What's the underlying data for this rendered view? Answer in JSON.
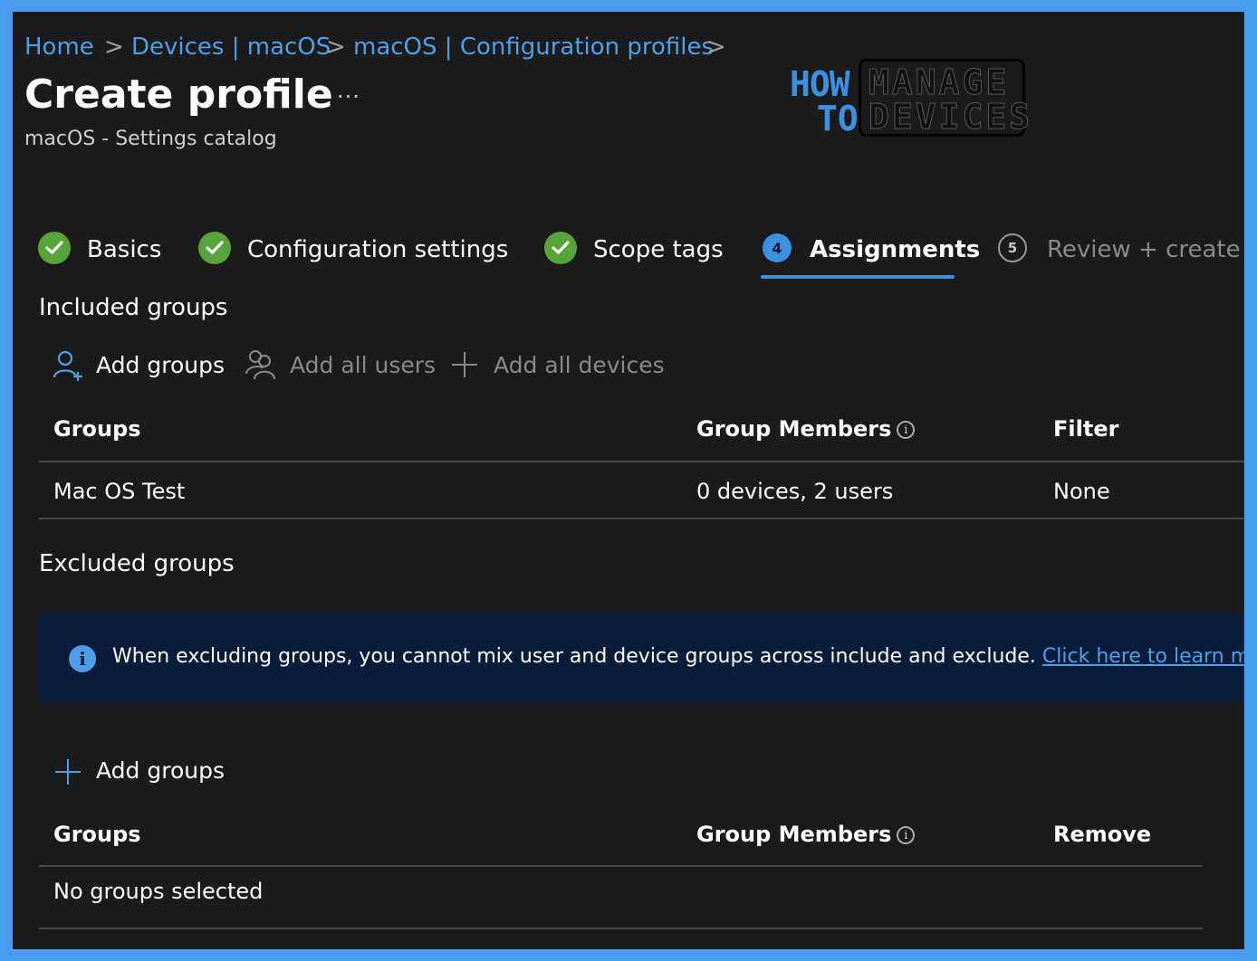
{
  "breadcrumb": {
    "items": [
      "Home",
      "Devices | macOS",
      "macOS | Configuration profiles"
    ],
    "separator": ">"
  },
  "page": {
    "title": "Create profile",
    "more": "···",
    "subtitle": "macOS - Settings catalog"
  },
  "logo": {
    "how": "HOW",
    "to": "TO",
    "manage": "MANAGE",
    "devices": "DEVICES"
  },
  "steps": [
    {
      "label": "Basics",
      "state": "done"
    },
    {
      "label": "Configuration settings",
      "state": "done"
    },
    {
      "label": "Scope tags",
      "state": "done"
    },
    {
      "number": "4",
      "label": "Assignments",
      "state": "active"
    },
    {
      "number": "5",
      "label": "Review + create",
      "state": "inactive"
    }
  ],
  "included": {
    "title": "Included groups",
    "commands": {
      "add_groups": "Add groups",
      "add_all_users": "Add all users",
      "add_all_devices": "Add all devices"
    },
    "columns": [
      "Groups",
      "Group Members",
      "Filter"
    ],
    "rows": [
      {
        "group": "Mac OS Test",
        "members": "0 devices, 2 users",
        "filter": "None"
      }
    ]
  },
  "excluded": {
    "title": "Excluded groups",
    "info": {
      "text": "When excluding groups, you cannot mix user and device groups across include and exclude. ",
      "link": "Click here to learn more ab"
    },
    "add_groups": "Add groups",
    "columns": [
      "Groups",
      "Group Members",
      "Remove"
    ],
    "empty": "No groups selected"
  },
  "colors": {
    "accent": "#3d8fe0",
    "link": "#4f9fe8",
    "success": "#57a43a",
    "background": "#1b1b1b",
    "border": "#4a9cf0",
    "banner": "#091d3a"
  }
}
